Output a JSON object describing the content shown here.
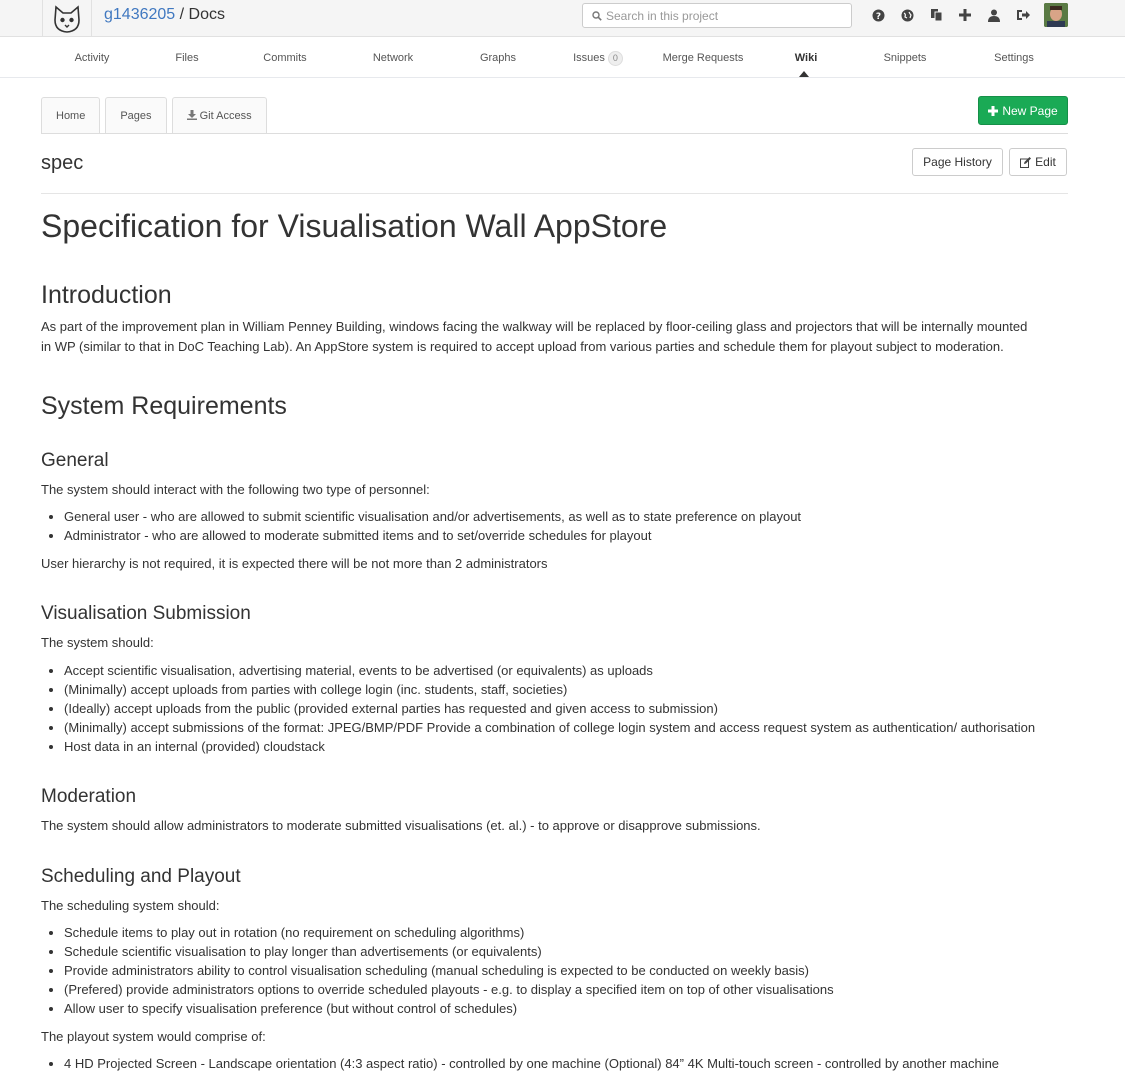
{
  "header": {
    "group": "g1436205",
    "separator": "/",
    "project": "Docs",
    "search_placeholder": "Search in this project",
    "icons": [
      "help-icon",
      "globe-icon",
      "copy-icon",
      "plus-icon",
      "user-icon",
      "sign-out-icon"
    ]
  },
  "nav": {
    "items": [
      {
        "label": "Activity"
      },
      {
        "label": "Files"
      },
      {
        "label": "Commits"
      },
      {
        "label": "Network"
      },
      {
        "label": "Graphs"
      },
      {
        "label": "Issues",
        "badge": "0"
      },
      {
        "label": "Merge Requests"
      },
      {
        "label": "Wiki",
        "active": true
      },
      {
        "label": "Snippets"
      },
      {
        "label": "Settings"
      }
    ]
  },
  "wiki": {
    "tabs": [
      "Home",
      "Pages",
      "Git Access"
    ],
    "new_page": "New Page",
    "page_name": "spec",
    "page_history": "Page History",
    "edit": "Edit"
  },
  "doc": {
    "title": "Specification for Visualisation Wall AppStore",
    "intro_heading": "Introduction",
    "intro_text": "As part of the improvement plan in William Penney Building, windows facing the walkway will be replaced by floor-ceiling glass and projectors that will be internally mounted in WP (similar to that in DoC Teaching Lab). An AppStore system is required to accept upload from various parties and schedule them for playout subject to moderation.",
    "sysreq_heading": "System Requirements",
    "general_heading": "General",
    "general_text": "The system should interact with the following two type of personnel:",
    "general_items": [
      "General user - who are allowed to submit scientific visualisation and/or advertisements, as well as to state preference on playout",
      "Administrator - who are allowed to moderate submitted items and to set/override schedules for playout"
    ],
    "general_note": "User hierarchy is not required, it is expected there will be not more than 2 administrators",
    "vis_heading": "Visualisation Submission",
    "vis_text": "The system should:",
    "vis_items": [
      "Accept scientific visualisation, advertising material, events to be advertised (or equivalents) as uploads",
      "(Minimally) accept uploads from parties with college login (inc. students, staff, societies)",
      "(Ideally) accept uploads from the public (provided external parties has requested and given access to submission)",
      "(Minimally) accept submissions of the format: JPEG/BMP/PDF Provide a combination of college login system and access request system as authentication/ authorisation",
      "Host data in an internal (provided) cloudstack"
    ],
    "mod_heading": "Moderation",
    "mod_text": "The system should allow administrators to moderate submitted visualisations (et. al.) - to approve or disapprove submissions.",
    "sched_heading": "Scheduling and Playout",
    "sched_text": "The scheduling system should:",
    "sched_items": [
      "Schedule items to play out in rotation (no requirement on scheduling algorithms)",
      "Schedule scientific visualisation to play longer than advertisements (or equivalents)",
      "Provide administrators ability to control visualisation scheduling (manual scheduling is expected to be conducted on weekly basis)",
      "(Prefered) provide administrators options to override scheduled playouts - e.g. to display a specified item on top of other visualisations",
      "Allow user to specify visualisation preference (but without control of schedules)"
    ],
    "playout_text": "The playout system would comprise of:",
    "playout_items": [
      "4 HD Projected Screen - Landscape orientation (4:3 aspect ratio) - controlled by one machine (Optional) 84” 4K Multi-touch screen - controlled by another machine"
    ]
  }
}
